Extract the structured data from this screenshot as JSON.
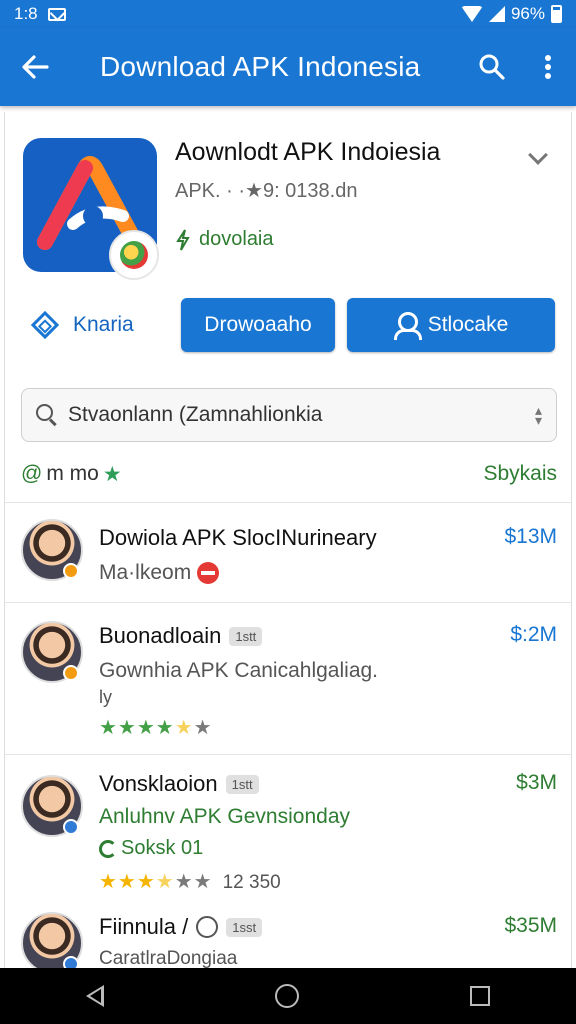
{
  "status_bar": {
    "time": "1:8",
    "battery": "96%"
  },
  "app_bar": {
    "title": "Download APK Indonesia"
  },
  "app_info": {
    "title": "Aownlodt APK Indoiesia",
    "subtitle": "APK.  ·  ·★9: 0138.dn",
    "download_note": "dovolaia"
  },
  "actions": {
    "outline_label": "Knaria",
    "primary_label": "Drowoaaho",
    "secondary_label": "Stlocake"
  },
  "search": {
    "value": "Stvaonlann (Zamnahlionkia"
  },
  "filter": {
    "left_label": "m mo",
    "right_label": "Sbykais"
  },
  "list": [
    {
      "title": "Dowiola APK SlocINurineary",
      "subtitle": "Ma·lkeom",
      "price": "$13M"
    },
    {
      "title": "Buonadloain",
      "tag": "1stt",
      "subtitle": "Gownhia APK Canicahlgaliag.",
      "subtitle2": "ly",
      "price": "$:2M",
      "rating": 4.0
    },
    {
      "title": "Vonsklaoion",
      "tag": "1stt",
      "subtitle": "Anluhnv APK Gevnsionday",
      "link": "Soksk 01",
      "price": "$3M",
      "rating": 3.5,
      "count": "12 350"
    },
    {
      "title": "Fiinnula /",
      "tag": "1sst",
      "subtitle": "CaratlraDongiaa",
      "price": "$35M"
    }
  ],
  "colors": {
    "primary": "#1976d2",
    "accent_green": "#2e7d32",
    "star_yellow": "#f5b400"
  },
  "icons": [
    "back-arrow-icon",
    "search-icon",
    "more-vert-icon",
    "diamond-icon",
    "person-icon",
    "download-icon"
  ]
}
